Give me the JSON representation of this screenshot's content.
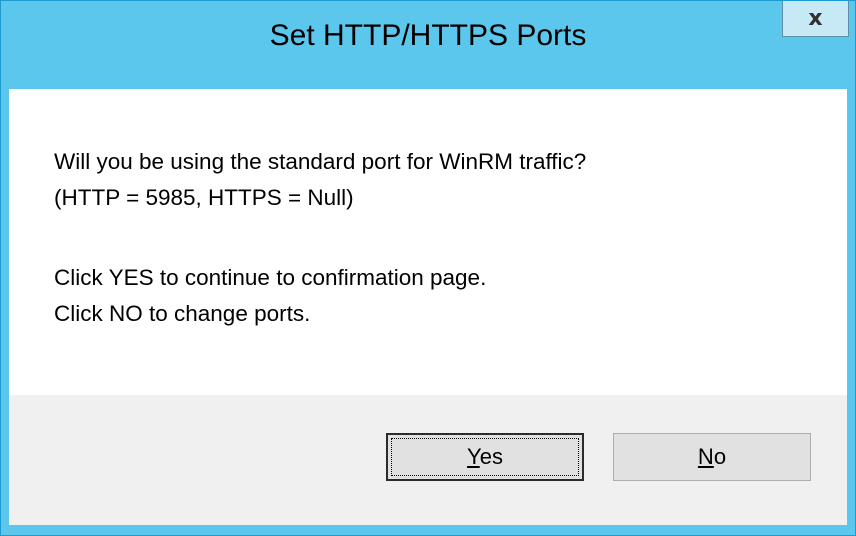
{
  "window": {
    "title": "Set HTTP/HTTPS Ports",
    "close_label": "x"
  },
  "message": {
    "line1": "Will you be using the standard port for WinRM traffic?",
    "line2": "(HTTP = 5985, HTTPS = Null)",
    "line3": "Click YES to continue to confirmation page.",
    "line4": "Click NO to change ports."
  },
  "buttons": {
    "yes": {
      "label": "Yes",
      "access_key": "Y",
      "rest": "es"
    },
    "no": {
      "label": "No",
      "access_key": "N",
      "rest": "o"
    }
  },
  "colors": {
    "titlebar": "#5bc7ec",
    "button_area": "#f0f0f0"
  },
  "icons": {
    "close": "close-icon"
  }
}
